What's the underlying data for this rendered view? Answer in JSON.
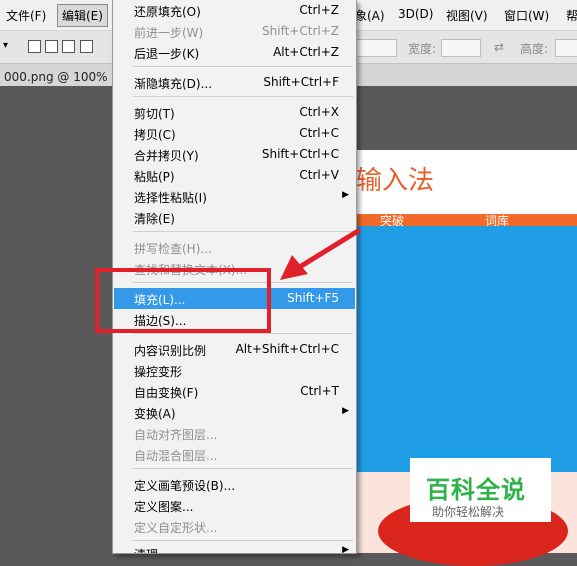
{
  "menubar": {
    "items": [
      {
        "label": "文件(F)"
      },
      {
        "label": "编辑(E)"
      },
      {
        "label": "象(A)"
      },
      {
        "label": "3D(D)"
      },
      {
        "label": "视图(V)"
      },
      {
        "label": "窗口(W)"
      },
      {
        "label": "帮"
      }
    ]
  },
  "options": {
    "width_label": "宽度:",
    "height_label": "高度:"
  },
  "doc_tab": {
    "title": "000.png @ 100% (图"
  },
  "canvas": {
    "title": "输入法",
    "tab1": "突破",
    "tab2": "词库"
  },
  "watermark": {
    "big": "百科全说",
    "small": "助你轻松解决"
  },
  "menu": {
    "items": [
      {
        "label": "还原填充(O)",
        "shortcut": "Ctrl+Z"
      },
      {
        "label": "前进一步(W)",
        "shortcut": "Shift+Ctrl+Z"
      },
      {
        "label": "后退一步(K)",
        "shortcut": "Alt+Ctrl+Z"
      },
      {
        "label": "渐隐填充(D)...",
        "shortcut": "Shift+Ctrl+F"
      },
      {
        "label": "剪切(T)",
        "shortcut": "Ctrl+X"
      },
      {
        "label": "拷贝(C)",
        "shortcut": "Ctrl+C"
      },
      {
        "label": "合并拷贝(Y)",
        "shortcut": "Shift+Ctrl+C"
      },
      {
        "label": "粘贴(P)",
        "shortcut": "Ctrl+V"
      },
      {
        "label": "选择性粘贴(I)",
        "shortcut": ""
      },
      {
        "label": "清除(E)",
        "shortcut": ""
      },
      {
        "label": "拼写检查(H)...",
        "shortcut": ""
      },
      {
        "label": "查找和替换文本(X)...",
        "shortcut": ""
      },
      {
        "label": "填充(L)...",
        "shortcut": "Shift+F5"
      },
      {
        "label": "描边(S)...",
        "shortcut": ""
      },
      {
        "label": "内容识别比例",
        "shortcut": "Alt+Shift+Ctrl+C"
      },
      {
        "label": "操控变形",
        "shortcut": ""
      },
      {
        "label": "自由变换(F)",
        "shortcut": "Ctrl+T"
      },
      {
        "label": "变换(A)",
        "shortcut": ""
      },
      {
        "label": "自动对齐图层...",
        "shortcut": ""
      },
      {
        "label": "自动混合图层...",
        "shortcut": ""
      },
      {
        "label": "定义画笔预设(B)...",
        "shortcut": ""
      },
      {
        "label": "定义图案...",
        "shortcut": ""
      },
      {
        "label": "定义自定形状...",
        "shortcut": ""
      },
      {
        "label": "清理",
        "shortcut": ""
      }
    ]
  },
  "colors": {
    "highlight": "#3399e8",
    "annotation": "#e1212a",
    "accent": "#f26a29",
    "canvas_blue": "#1f9ee6"
  },
  "icons": [
    "submenu-arrow-icon",
    "annotation-arrow-icon",
    "selection-mode-icon",
    "swap-icon"
  ]
}
